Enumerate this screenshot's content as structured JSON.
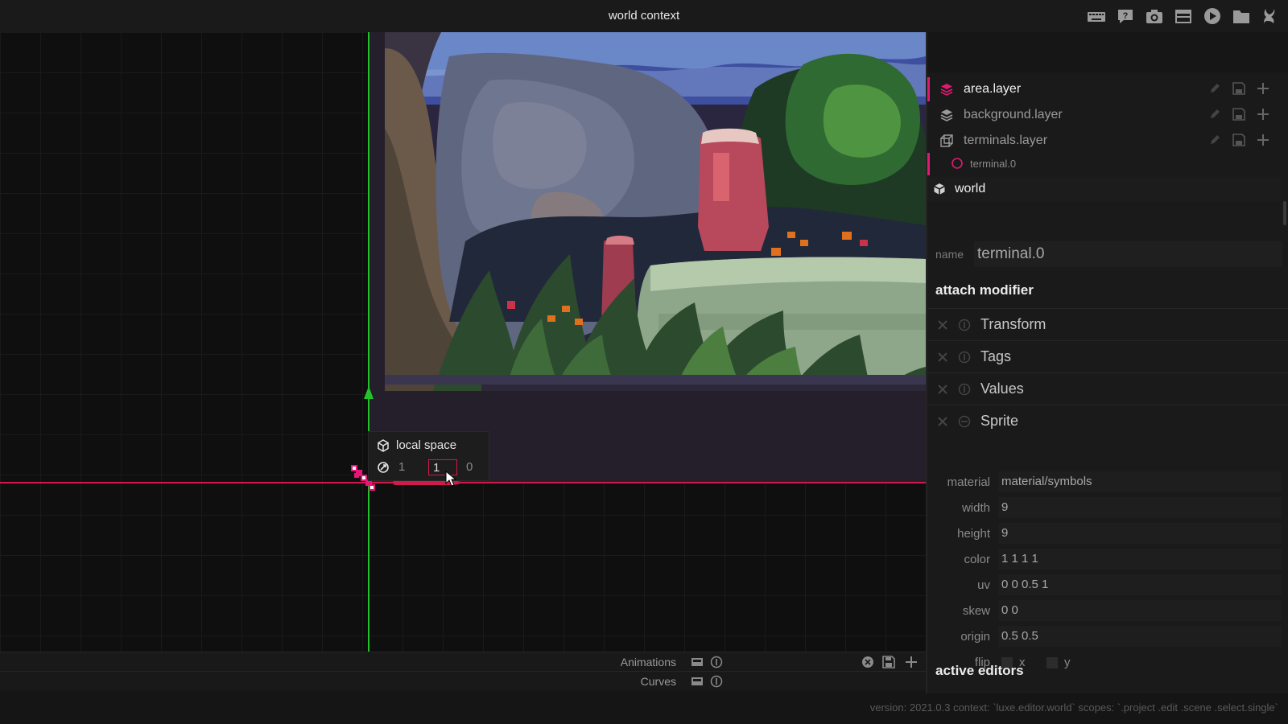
{
  "window": {
    "title": "world context"
  },
  "toolbar": {
    "buttons": [
      "keyboard-icon",
      "help-icon",
      "camera-icon",
      "window-icon",
      "play-icon",
      "folder-icon",
      "luxe-icon"
    ]
  },
  "viewport": {
    "local_space": {
      "title": "local space",
      "values": [
        "1",
        "1",
        "0"
      ]
    }
  },
  "timeline": {
    "animations_label": "Animations",
    "curves_label": "Curves"
  },
  "layers": [
    {
      "name": "area.layer",
      "icon": "layers-icon",
      "selected": true
    },
    {
      "name": "background.layer",
      "icon": "layers-icon",
      "selected": false
    },
    {
      "name": "terminals.layer",
      "icon": "cube-outline-icon",
      "selected": false
    }
  ],
  "terminal_item": "terminal.0",
  "world_item": "world",
  "inspector": {
    "name_label": "name",
    "name_value": "terminal.0",
    "attach_modifier": "attach modifier",
    "modifiers": [
      "Transform",
      "Tags",
      "Values",
      "Sprite"
    ],
    "sprite_props": {
      "material": {
        "label": "material",
        "value": "material/symbols"
      },
      "width": {
        "label": "width",
        "value": "9"
      },
      "height": {
        "label": "height",
        "value": "9"
      },
      "color": {
        "label": "color",
        "value": "1 1 1 1"
      },
      "uv": {
        "label": "uv",
        "value": "0 0 0.5 1"
      },
      "skew": {
        "label": "skew",
        "value": "0 0"
      },
      "origin": {
        "label": "origin",
        "value": "0.5 0.5"
      },
      "flip": {
        "label": "flip",
        "x": "x",
        "y": "y"
      }
    },
    "active_editors": "active editors"
  },
  "status": "version: 2021.0.3 context: `luxe.editor.world` scopes: `.project .edit .scene .select.single`",
  "colors": {
    "accent": "#e01a70",
    "axis_x": "#d01a4a",
    "axis_y": "#22c32a"
  }
}
